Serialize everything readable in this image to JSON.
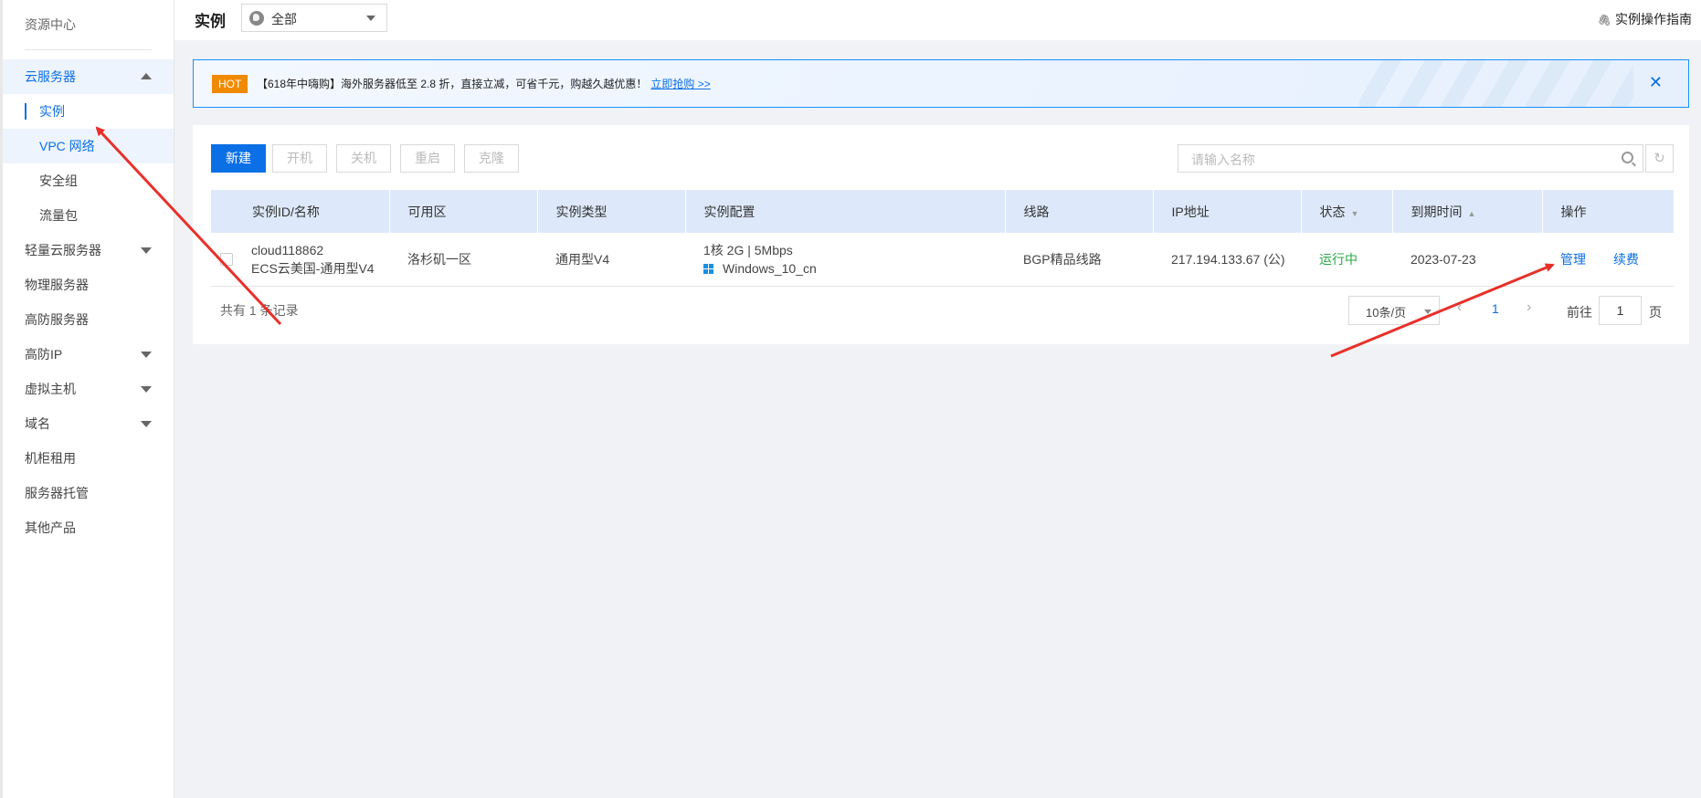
{
  "sidebar": {
    "header": "资源中心",
    "items": [
      {
        "label": "云服务器"
      },
      {
        "label": "实例"
      },
      {
        "label": "VPC 网络"
      },
      {
        "label": "安全组"
      },
      {
        "label": "流量包"
      },
      {
        "label": "轻量云服务器"
      },
      {
        "label": "物理服务器"
      },
      {
        "label": "高防服务器"
      },
      {
        "label": "高防IP"
      },
      {
        "label": "虚拟主机"
      },
      {
        "label": "域名"
      },
      {
        "label": "机柜租用"
      },
      {
        "label": "服务器托管"
      },
      {
        "label": "其他产品"
      }
    ]
  },
  "header": {
    "title": "实例",
    "region": "全部",
    "guide": "实例操作指南"
  },
  "promo": {
    "badge": "HOT",
    "text": "【618年中嗨购】海外服务器低至 2.8 折，直接立减，可省千元，购越久越优惠！",
    "link": "立即抢购 >>",
    "close": "✕"
  },
  "toolbar": {
    "new": "新建",
    "start": "开机",
    "stop": "关机",
    "restart": "重启",
    "clone": "克隆",
    "search_placeholder": "请输入名称"
  },
  "table": {
    "headers": [
      "实例ID/名称",
      "可用区",
      "实例类型",
      "实例配置",
      "线路",
      "IP地址",
      "状态",
      "到期时间",
      "操作"
    ],
    "rows": [
      {
        "id": "cloud118862",
        "name": "ECS云美国-通用型V4",
        "zone": "洛杉矶一区",
        "type": "通用型V4",
        "config": "1核 2G | 5Mbps",
        "os": "Windows_10_cn",
        "line": "BGP精品线路",
        "ip": "217.194.133.67 (公)",
        "status": "运行中",
        "expire": "2023-07-23",
        "op_manage": "管理",
        "op_renew": "续费"
      }
    ]
  },
  "pagination": {
    "total": "共有 1 条记录",
    "page_size": "10条/页",
    "current": "1",
    "goto_label": "前往",
    "goto_value": "1",
    "goto_suffix": "页"
  },
  "colors": {
    "accent": "#0b6fe6",
    "hot": "#f08a00",
    "running": "#2aa845",
    "annotation_arrow": "#e8302a"
  }
}
